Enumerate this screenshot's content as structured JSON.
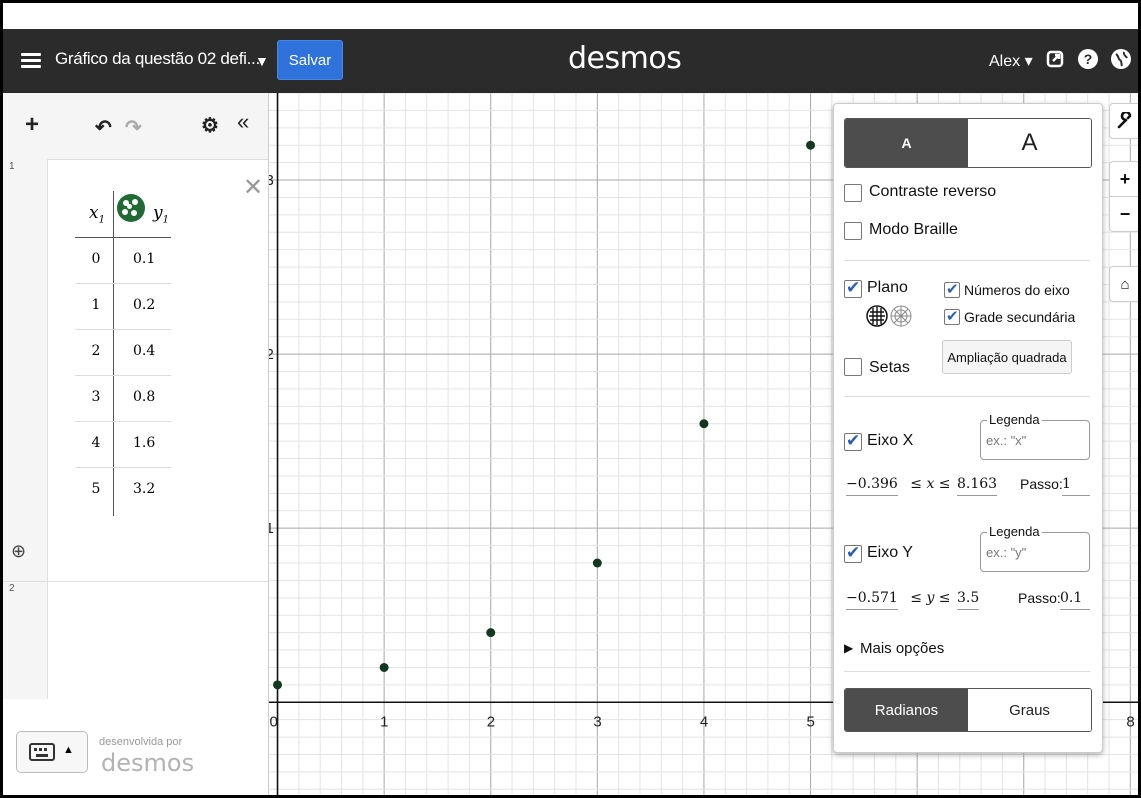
{
  "header": {
    "graph_title": "Gráfico da questão 02 defi...",
    "save_label": "Salvar",
    "brand": "desmos",
    "user": "Alex ▾"
  },
  "icons": [
    "hamburger-icon",
    "caret-down-icon",
    "share-icon",
    "help-icon",
    "globe-icon",
    "plus-icon",
    "undo-icon",
    "redo-icon",
    "gear-icon",
    "collapse-icon",
    "close-icon",
    "zoom-icon",
    "keyboard-icon",
    "wrench-icon",
    "zoom-in-icon",
    "zoom-out-icon",
    "home-icon"
  ],
  "expressions": {
    "rows": [
      "1",
      "2"
    ],
    "table": {
      "head_x": "x",
      "head_x_sub": "1",
      "head_y": "y",
      "head_y_sub": "1",
      "point_color": "#1f6b33",
      "rows": [
        {
          "x": "0",
          "y": "0.1"
        },
        {
          "x": "1",
          "y": "0.2"
        },
        {
          "x": "2",
          "y": "0.4"
        },
        {
          "x": "3",
          "y": "0.8"
        },
        {
          "x": "4",
          "y": "1.6"
        },
        {
          "x": "5",
          "y": "3.2"
        }
      ]
    }
  },
  "footer": {
    "powered_by": "desenvolvida por",
    "brand": "desmos"
  },
  "graph": {
    "x_ticks": [
      "0",
      "1",
      "2",
      "3",
      "4",
      "5",
      "8"
    ],
    "y_ticks": [
      "1",
      "2",
      "3"
    ],
    "xmin": -0.08,
    "xmax": 8.1,
    "ymin": -0.55,
    "ymax": 3.5,
    "points": [
      [
        0,
        0.1
      ],
      [
        1,
        0.2
      ],
      [
        2,
        0.4
      ],
      [
        3,
        0.8
      ],
      [
        4,
        1.6
      ],
      [
        5,
        3.2
      ]
    ],
    "point_color": "#12381f"
  },
  "settings": {
    "text_size_small": "A",
    "text_size_large": "A",
    "contrast": "Contraste reverso",
    "braille": "Modo Braille",
    "grid": "Plano",
    "arrows": "Setas",
    "axis_numbers": "Números do eixo",
    "minor_grid": "Grade secundária",
    "square": "Ampliação quadrada",
    "x_axis": "Eixo X",
    "y_axis": "Eixo Y",
    "legend": "Legenda",
    "legend_x_placeholder": "ex.: \"x\"",
    "legend_y_placeholder": "ex.: \"y\"",
    "x_min": "−0.396",
    "x_max": "8.163",
    "x_ineq": "≤ x ≤",
    "x_step_label": "Passo:",
    "x_step": "1",
    "y_min": "−0.571",
    "y_max": "3.5",
    "y_ineq": "≤ y ≤",
    "y_step_label": "Passo:",
    "y_step": "0.1",
    "more": "Mais opções",
    "radians": "Radianos",
    "degrees": "Graus"
  }
}
